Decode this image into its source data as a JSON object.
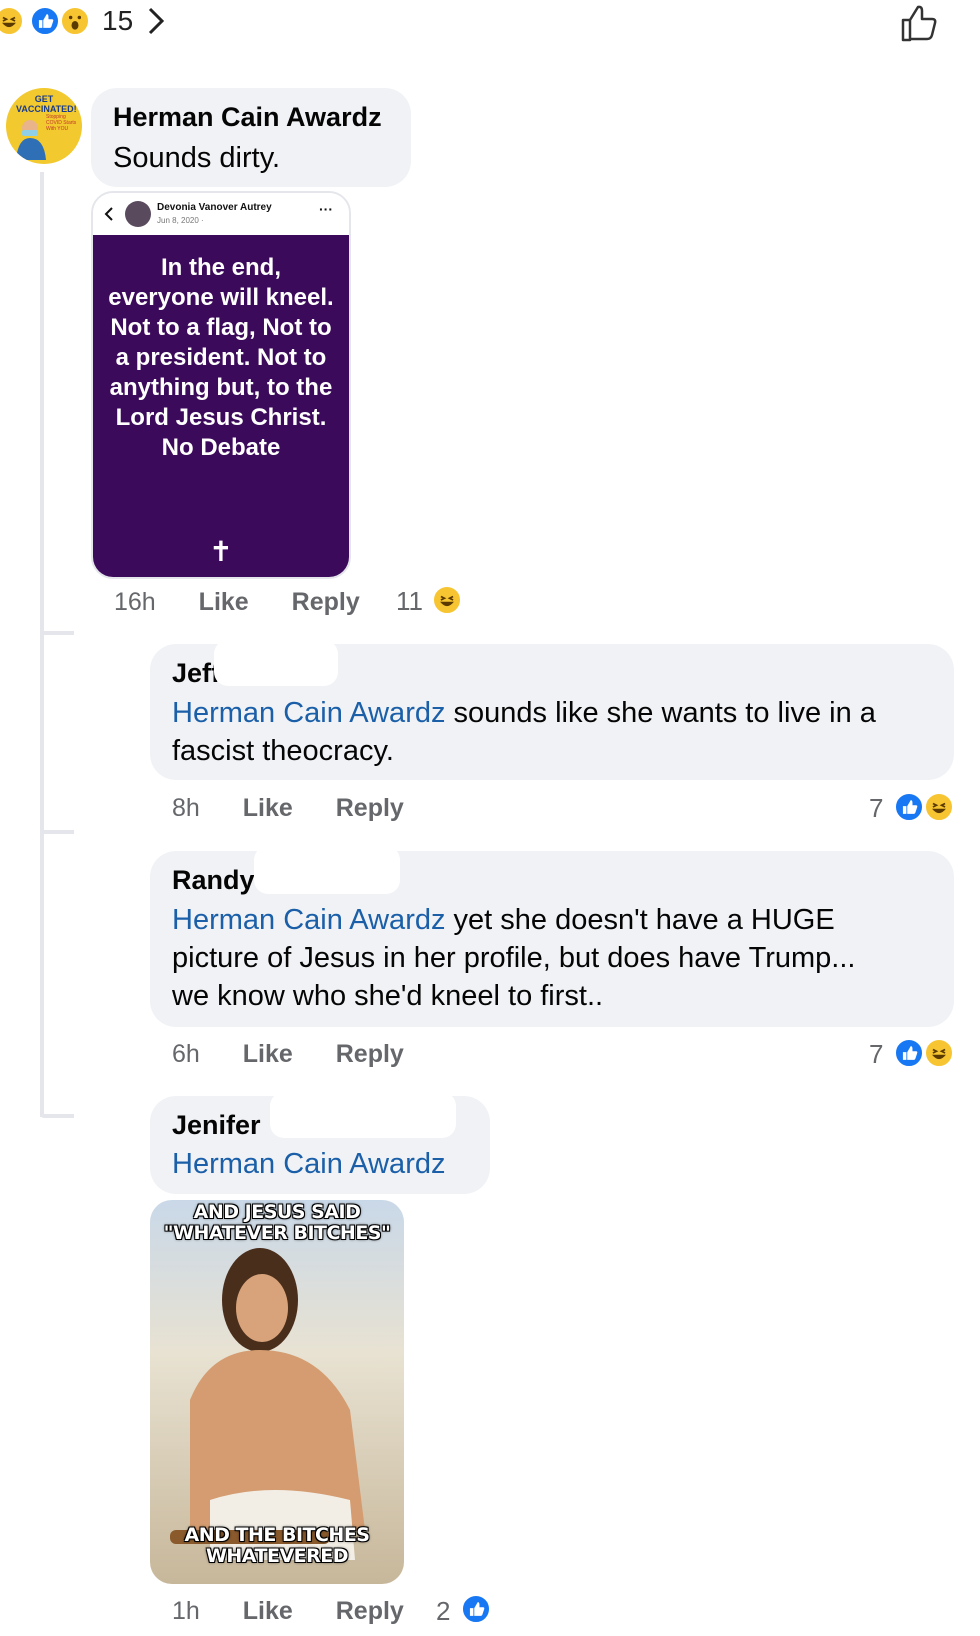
{
  "top_reactions": {
    "icons": [
      "haha-icon",
      "like-icon",
      "wow-icon"
    ],
    "count": "15"
  },
  "comments": [
    {
      "author": "Herman Cain Awardz",
      "text": "Sounds dirty.",
      "avatar_text": "GET VACCINATED!",
      "avatar_subtext": "Stopping COVID Starts With YOU",
      "attached_post": {
        "author": "Devonia Vanover Autrey",
        "date": "Jun 8, 2020 · ",
        "body": "In the end, everyone will kneel. Not to a flag, Not to a president. Not to anything but, to the Lord Jesus Christ. No Debate",
        "symbol": "✝"
      },
      "time": "16h",
      "like": "Like",
      "reply": "Reply",
      "reaction_count": "11"
    }
  ],
  "replies": [
    {
      "author": "Jeff",
      "mention": "Herman Cain Awardz",
      "text_line1_rest": " sounds like she wants to live in a",
      "text_line2": "fascist theocracy.",
      "time": "8h",
      "like": "Like",
      "reply": "Reply",
      "reaction_count": "7"
    },
    {
      "author": "Randy",
      "mention": "Herman Cain Awardz",
      "text_line1_rest": " yet she doesn't have a HUGE",
      "text_line2": "picture of Jesus in her profile, but does have Trump...",
      "text_line3": "we know who she'd kneel to first..",
      "time": "6h",
      "like": "Like",
      "reply": "Reply",
      "reaction_count": "7"
    },
    {
      "author": "Jenifer",
      "mention": "Herman Cain Awardz",
      "meme_top": "AND JESUS SAID \"WHATEVER BITCHES\"",
      "meme_bottom": "AND THE BITCHES WHATEVERED",
      "time": "1h",
      "like": "Like",
      "reply": "Reply",
      "reaction_count": "2"
    }
  ],
  "colors": {
    "facebook_blue": "#1877f2",
    "mention_blue": "#1a5fa8",
    "bubble_gray": "#f0f2f5",
    "meta_gray": "#65676b",
    "post_purple": "#3c0a5a"
  }
}
